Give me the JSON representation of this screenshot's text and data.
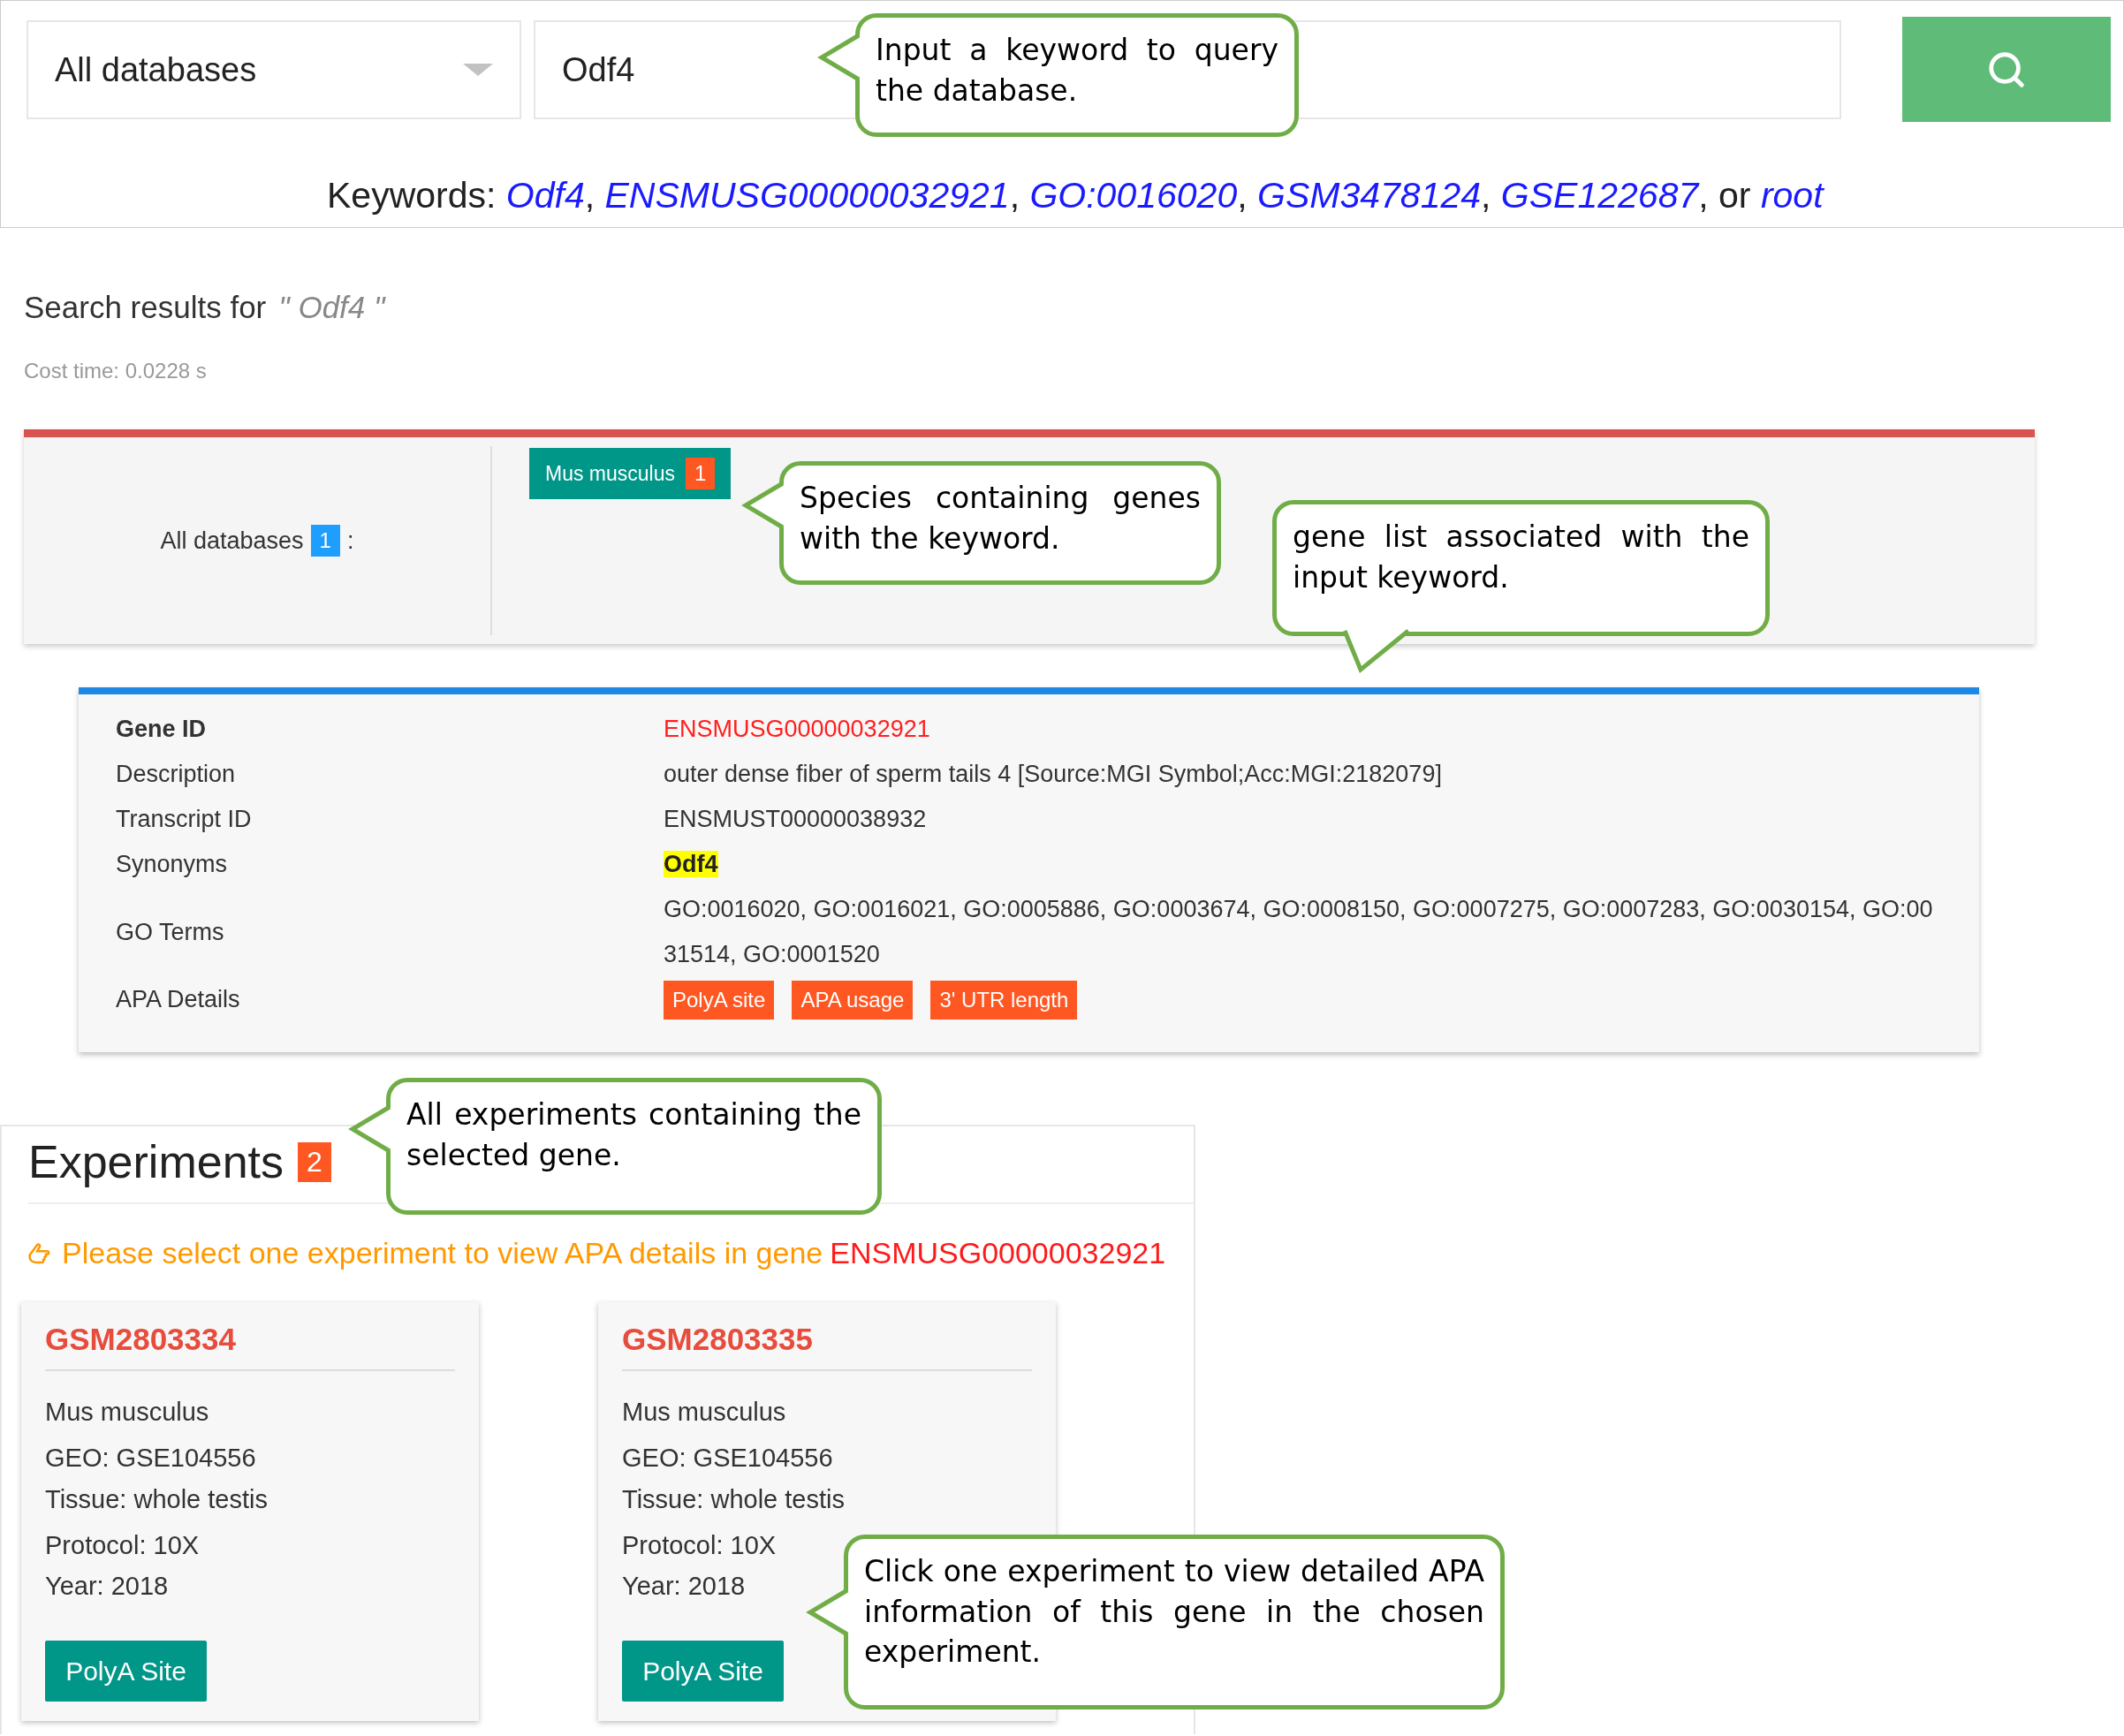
{
  "search": {
    "database": "All databases",
    "query": "Odf4"
  },
  "keywords": {
    "label": "Keywords:",
    "links": [
      {
        "text": "Odf4",
        "suffix": ","
      },
      {
        "text": "ENSMUSG00000032921",
        "suffix": ","
      },
      {
        "text": "GO:0016020",
        "suffix": ","
      },
      {
        "text": "GSM3478124",
        "suffix": ","
      },
      {
        "text": "GSE122687",
        "suffix": ", or"
      },
      {
        "text": "root"
      }
    ]
  },
  "results": {
    "label": "Search results for",
    "query": "\" Odf4 \"",
    "cost_time": "Cost time: 0.0228 s"
  },
  "species_panel": {
    "database": "All databases",
    "count": "1",
    "separator": ":",
    "species": [
      {
        "name": "Mus musculus",
        "count": "1"
      }
    ]
  },
  "gene": {
    "fields": [
      {
        "label": "Gene ID",
        "value": "ENSMUSG00000032921",
        "kind": "id"
      },
      {
        "label": "Description",
        "value": "outer dense fiber of sperm tails 4 [Source:MGI Symbol;Acc:MGI:2182079]",
        "kind": "text"
      },
      {
        "label": "Transcript ID",
        "value": "ENSMUST00000038932",
        "kind": "text"
      },
      {
        "label": "Synonyms",
        "value": "Odf4",
        "kind": "highlight"
      },
      {
        "label": "GO Terms",
        "value": "GO:0016020, GO:0016021, GO:0005886, GO:0003674, GO:0008150, GO:0007275, GO:0007283, GO:0030154, GO:0031514, GO:0001520",
        "kind": "text"
      },
      {
        "label": "APA Details",
        "tags": [
          "PolyA site",
          "APA usage",
          "3' UTR length"
        ],
        "kind": "tags"
      }
    ]
  },
  "experiments": {
    "title": "Experiments",
    "count": "2",
    "instruction": "Please select one experiment to view APA details in gene",
    "gene": "ENSMUSG00000032921",
    "cards": [
      {
        "id": "GSM2803334",
        "lines": [
          "Mus musculus",
          "GEO: GSE104556",
          "Tissue: whole testis",
          "Protocol: 10X",
          "Year: 2018"
        ],
        "button": "PolyA Site"
      },
      {
        "id": "GSM2803335",
        "lines": [
          "Mus musculus",
          "GEO: GSE104556",
          "Tissue: whole testis",
          "Protocol: 10X",
          "Year: 2018"
        ],
        "button": "PolyA Site"
      }
    ]
  },
  "callouts": [
    {
      "text": "Input a keyword to query the database.",
      "kind": "left"
    },
    {
      "text": "Species containing genes with the keyword.",
      "kind": "left"
    },
    {
      "text": "gene list associated with the input keyword.",
      "kind": "down"
    },
    {
      "text": "All experiments containing the selected gene.",
      "kind": "left"
    },
    {
      "text": "Click one experiment to view detailed APA information of this gene in the chosen experiment.",
      "kind": "left"
    }
  ]
}
